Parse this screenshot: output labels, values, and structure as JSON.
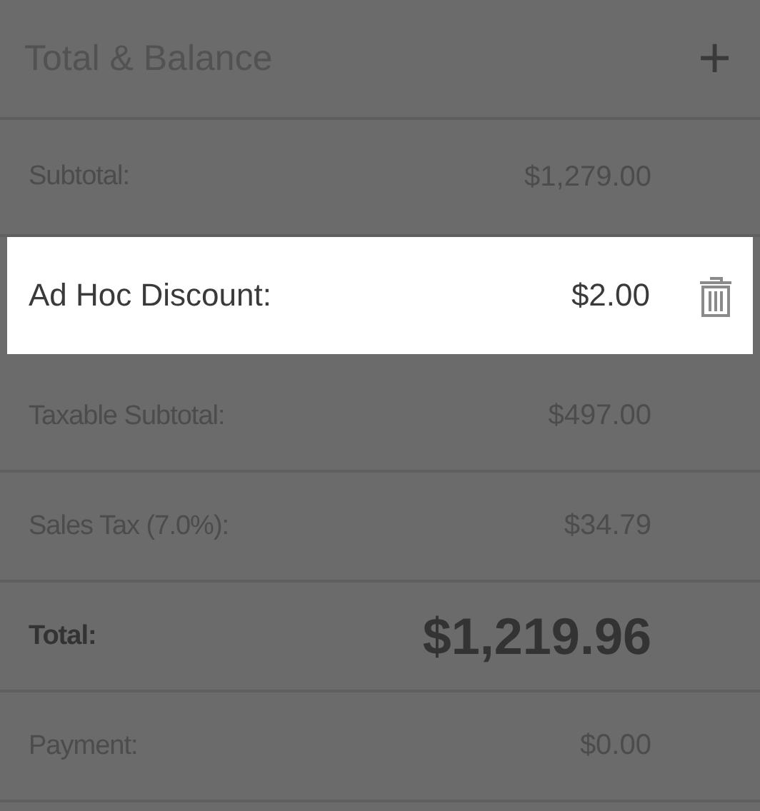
{
  "header": {
    "title": "Total & Balance",
    "add_icon": "+"
  },
  "rows": [
    {
      "kind": "normal",
      "label": "Subtotal:",
      "value": "$1,279.00",
      "selected": false,
      "deletable": false
    },
    {
      "kind": "normal",
      "label": "Ad Hoc Discount:",
      "value": "$2.00",
      "selected": true,
      "deletable": true
    },
    {
      "kind": "normal",
      "label": "Taxable Subtotal:",
      "value": "$497.00",
      "selected": false,
      "deletable": false
    },
    {
      "kind": "normal",
      "label": "Sales Tax (7.0%):",
      "value": "$34.79",
      "selected": false,
      "deletable": false
    },
    {
      "kind": "total",
      "label": "Total:",
      "value": "$1,219.96",
      "selected": false,
      "deletable": false
    },
    {
      "kind": "normal",
      "label": "Payment:",
      "value": "$0.00",
      "selected": false,
      "deletable": false
    }
  ]
}
